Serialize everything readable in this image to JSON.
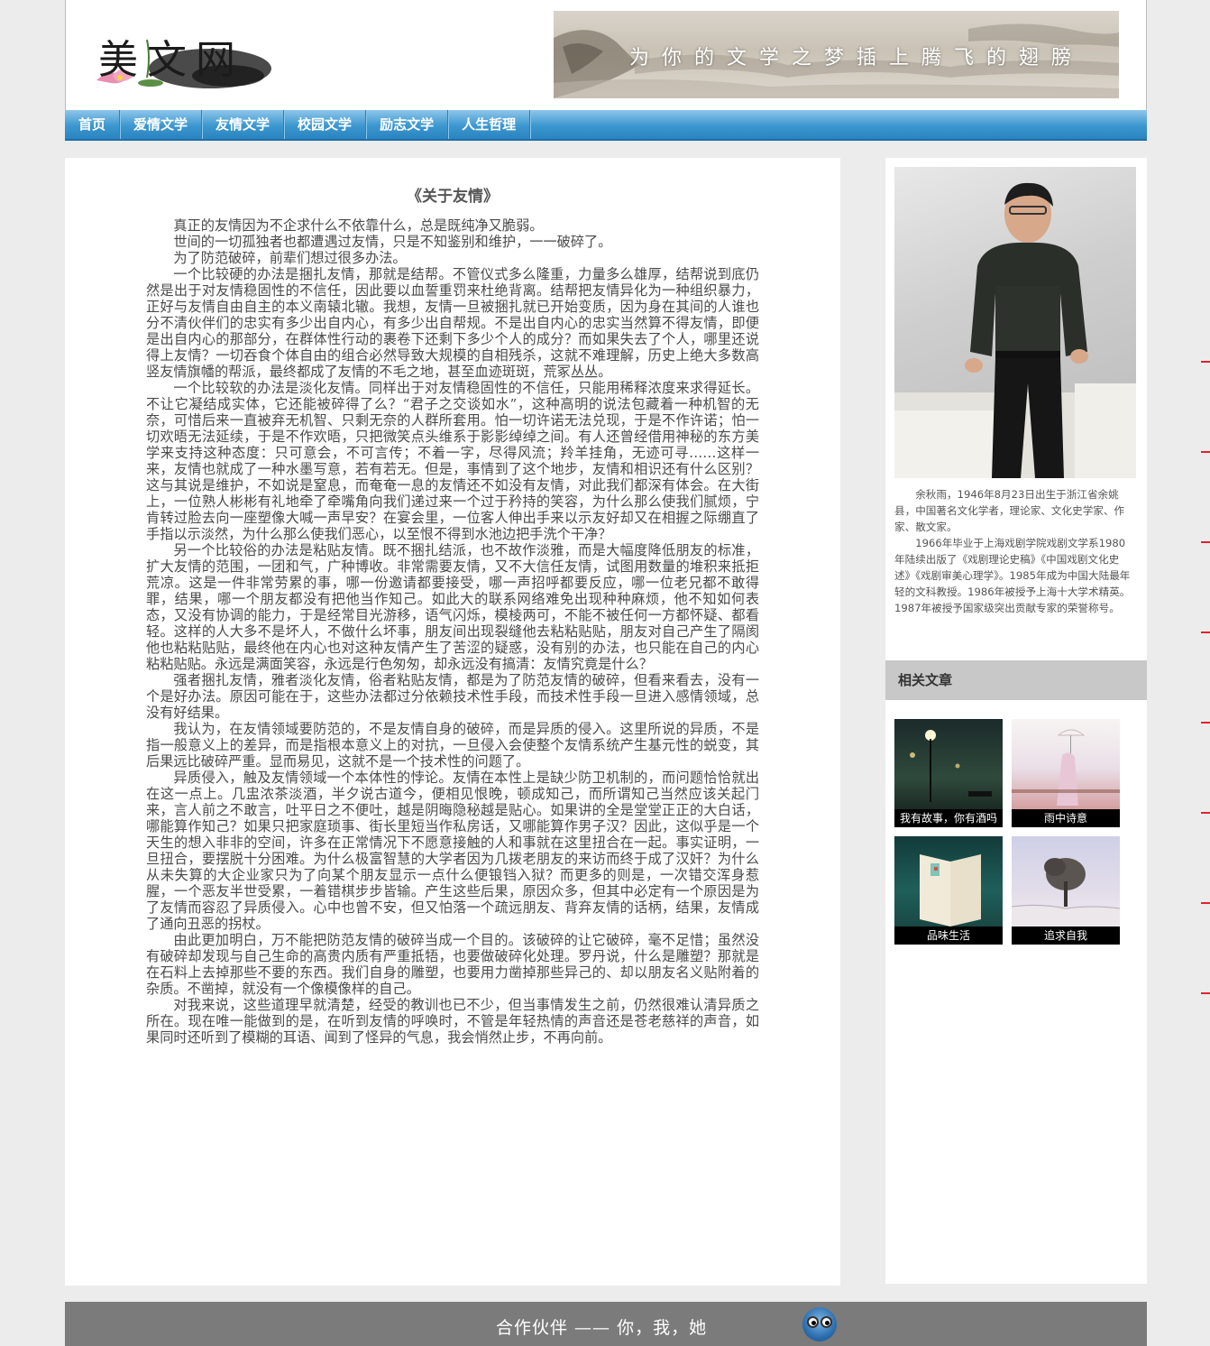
{
  "header": {
    "logo_text": "美文网",
    "slogan": "为你的文学之梦插上腾飞的翅膀"
  },
  "nav": {
    "items": [
      "首页",
      "爱情文学",
      "友情文学",
      "校园文学",
      "励志文学",
      "人生哲理"
    ]
  },
  "article": {
    "title": "《关于友情》",
    "paragraphs": [
      "真正的友情因为不企求什么不依靠什么，总是既纯净又脆弱。",
      "世间的一切孤独者也都遭遇过友情，只是不知鉴别和维护，一一破碎了。",
      "为了防范破碎，前辈们想过很多办法。",
      "一个比较硬的办法是捆扎友情，那就是结帮。不管仪式多么隆重，力量多么雄厚，结帮说到底仍然是出于对友情稳固性的不信任，因此要以血誓重罚来杜绝背离。结帮把友情异化为一种组织暴力，正好与友情自由自主的本义南辕北辙。我想，友情一旦被捆扎就已开始变质，因为身在其间的人谁也分不清伙伴们的忠实有多少出自内心，有多少出自帮规。不是出自内心的忠实当然算不得友情，即便是出自内心的那部分，在群体性行动的裹卷下还剩下多少个人的成分？而如果失去了个人，哪里还说得上友情？一切吞食个体自由的组合必然导致大规模的自相残杀，这就不难理解，历史上绝大多数高竖友情旗幡的帮派，最终都成了友情的不毛之地，甚至血迹斑斑，荒冢丛丛。",
      "一个比较软的办法是淡化友情。同样出于对友情稳固性的不信任，只能用稀释浓度来求得延长。不让它凝结成实体，它还能被碎得了么？“君子之交谈如水”，这种高明的说法包藏着一种机智的无奈，可惜后来一直被弃无机智、只剩无奈的人群所套用。怕一切许诺无法兑现，于是不作许诺；怕一切欢晤无法延续，于是不作欢晤，只把微笑点头维系于影影绰绰之间。有人还曾经借用神秘的东方美学来支持这种态度：只可意会，不可言传；不着一字，尽得风流；羚羊挂角，无迹可寻……这样一来，友情也就成了一种水墨写意，若有若无。但是，事情到了这个地步，友情和相识还有什么区别？这与其说是维护，不如说是窒息，而奄奄一息的友情还不如没有友情，对此我们都深有体会。在大街上，一位熟人彬彬有礼地牵了牵嘴角向我们递过来一个过于矜持的笑容，为什么那么使我们腻烦，宁肯转过脸去向一座塑像大喊一声早安？在宴会里，一位客人伸出手来以示友好却又在相握之际绷直了手指以示淡然，为什么那么使我们恶心，以至恨不得到水池边把手洗个干净？",
      "另一个比较俗的办法是粘贴友情。既不捆扎结派，也不故作淡雅，而是大幅度降低朋友的标准，扩大友情的范围，一团和气，广种博收。非常需要友情，又不大信任友情，试图用数量的堆积来抵拒荒凉。这是一件非常劳累的事，哪一份邀请都要接受，哪一声招呼都要反应，哪一位老兄都不敢得罪，结果，哪一个朋友都没有把他当作知己。如此大的联系网络难免出现种种麻烦，他不知如何表态，又没有协调的能力，于是经常目光游移，语气闪烁，模棱两可，不能不被任何一方都怀疑、都看轻。这样的人大多不是坏人，不做什么坏事，朋友间出现裂缝他去粘粘贴贴，朋友对自己产生了隔阂他也粘粘贴贴，最终他在内心也对这种友情产生了苦涩的疑惑，没有别的办法，也只能在自己的内心粘粘贴贴。永远是满面笑容，永远是行色匆匆，却永远没有搞清：友情究竟是什么？",
      "强者捆扎友情，雅者淡化友情，俗者粘贴友情，都是为了防范友情的破碎，但看来看去，没有一个是好办法。原因可能在于，这些办法都过分依赖技术性手段，而技术性手段一旦进入感情领域，总没有好结果。",
      "我认为，在友情领域要防范的，不是友情自身的破碎，而是异质的侵入。这里所说的异质，不是指一般意义上的差异，而是指根本意义上的对抗，一旦侵入会使整个友情系统产生基元性的蜕变，其后果远比破碎严重。显而易见，这就不是一个技术性的问题了。",
      "异质侵入，触及友情领域一个本体性的悖论。友情在本性上是缺少防卫机制的，而问题恰恰就出在这一点上。几盅浓茶淡酒，半夕说古道今，便相见恨晚，顿成知己，而所谓知己当然应该关起门来，言人前之不敢言，吐平日之不便吐，越是阴晦隐秘越是贴心。如果讲的全是堂堂正正的大白话，哪能算作知己？如果只把家庭琐事、街长里短当作私房话，又哪能算作男子汉？因此，这似乎是一个天生的想入非非的空间，许多在正常情况下不愿意接触的人和事就在这里扭合在一起。事实证明，一旦扭合，要摆脱十分困难。为什么极富智慧的大学者因为几拨老朋友的来访而终于成了汉奸？为什么从未失算的大企业家只为了向某个朋友显示一点什么便锒铛入狱？而更多的则是，一次错交浑身惹腥，一个恶友半世受累，一着错棋步步皆输。产生这些后果，原因众多，但其中必定有一个原因是为了友情而容忍了异质侵入。心中也曾不安，但又怕落一个疏远朋友、背弃友情的话柄，结果，友情成了通向丑恶的拐杖。",
      "由此更加明白，万不能把防范友情的破碎当成一个目的。该破碎的让它破碎，毫不足惜；虽然没有破碎却发现与自己生命的高贵内质有严重抵牾，也要做破碎化处理。罗丹说，什么是雕塑？那就是在石料上去掉那些不要的东西。我们自身的雕塑，也要用力凿掉那些异己的、却以朋友名义贴附着的杂质。不凿掉，就没有一个像模像样的自己。",
      "对我来说，这些道理早就清楚，经受的教训也已不少，但当事情发生之前，仍然很难认清异质之所在。现在唯一能做到的是，在听到友情的呼唤时，不管是年轻热情的声音还是苍老慈祥的声音，如果同时还听到了模糊的耳语、闻到了怪异的气息，我会悄然止步，不再向前。"
    ]
  },
  "sidebar": {
    "bio": [
      "余秋雨，1946年8月23日出生于浙江省余姚县，中国著名文化学者，理论家、文化史学家、作家、散文家。",
      "1966年毕业于上海戏剧学院戏剧文学系1980年陆续出版了《戏剧理论史稿》《中国戏剧文化史述》《戏剧审美心理学》。1985年成为中国大陆最年轻的文科教授。1986年被授予上海十大学术精英。1987年被授予国家级突出贡献专家的荣誉称号。"
    ],
    "related_heading": "相关文章",
    "related": [
      {
        "caption": "我有故事，你有酒吗"
      },
      {
        "caption": "雨中诗意"
      },
      {
        "caption": "品味生活"
      },
      {
        "caption": "追求自我"
      }
    ]
  },
  "footer": {
    "text": "合作伙伴 —— 你，我，她"
  }
}
